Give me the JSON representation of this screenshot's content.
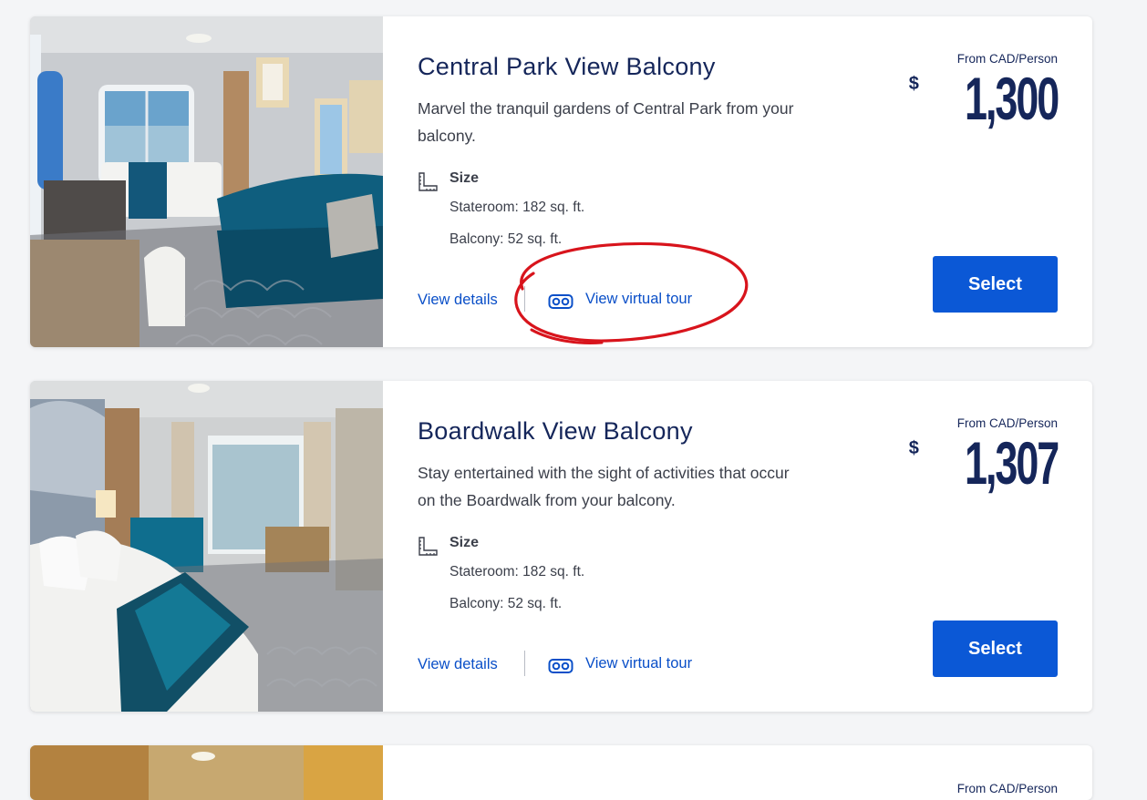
{
  "rooms": [
    {
      "title": "Central Park View Balcony",
      "description": "Marvel the tranquil gardens of Central Park from your balcony.",
      "size_label": "Size",
      "stateroom_size": "Stateroom: 182 sq. ft.",
      "balcony_size": "Balcony: 52 sq. ft.",
      "view_details": "View details",
      "virtual_tour": "View virtual tour",
      "price_label": "From CAD/Person",
      "currency": "$",
      "price": "1,300",
      "select_label": "Select"
    },
    {
      "title": "Boardwalk View Balcony",
      "description": "Stay entertained with the sight of activities that occur on the Boardwalk from your balcony.",
      "size_label": "Size",
      "stateroom_size": "Stateroom: 182 sq. ft.",
      "balcony_size": "Balcony: 52 sq. ft.",
      "view_details": "View details",
      "virtual_tour": "View virtual tour",
      "price_label": "From CAD/Person",
      "currency": "$",
      "price": "1,307",
      "select_label": "Select"
    },
    {
      "price_label": "From CAD/Person"
    }
  ],
  "colors": {
    "heading": "#15265a",
    "link": "#0a4fc8",
    "button": "#0b58d6",
    "annotation": "#d8141c"
  },
  "icons": [
    "size-ruler-icon",
    "vr-goggles-icon"
  ]
}
